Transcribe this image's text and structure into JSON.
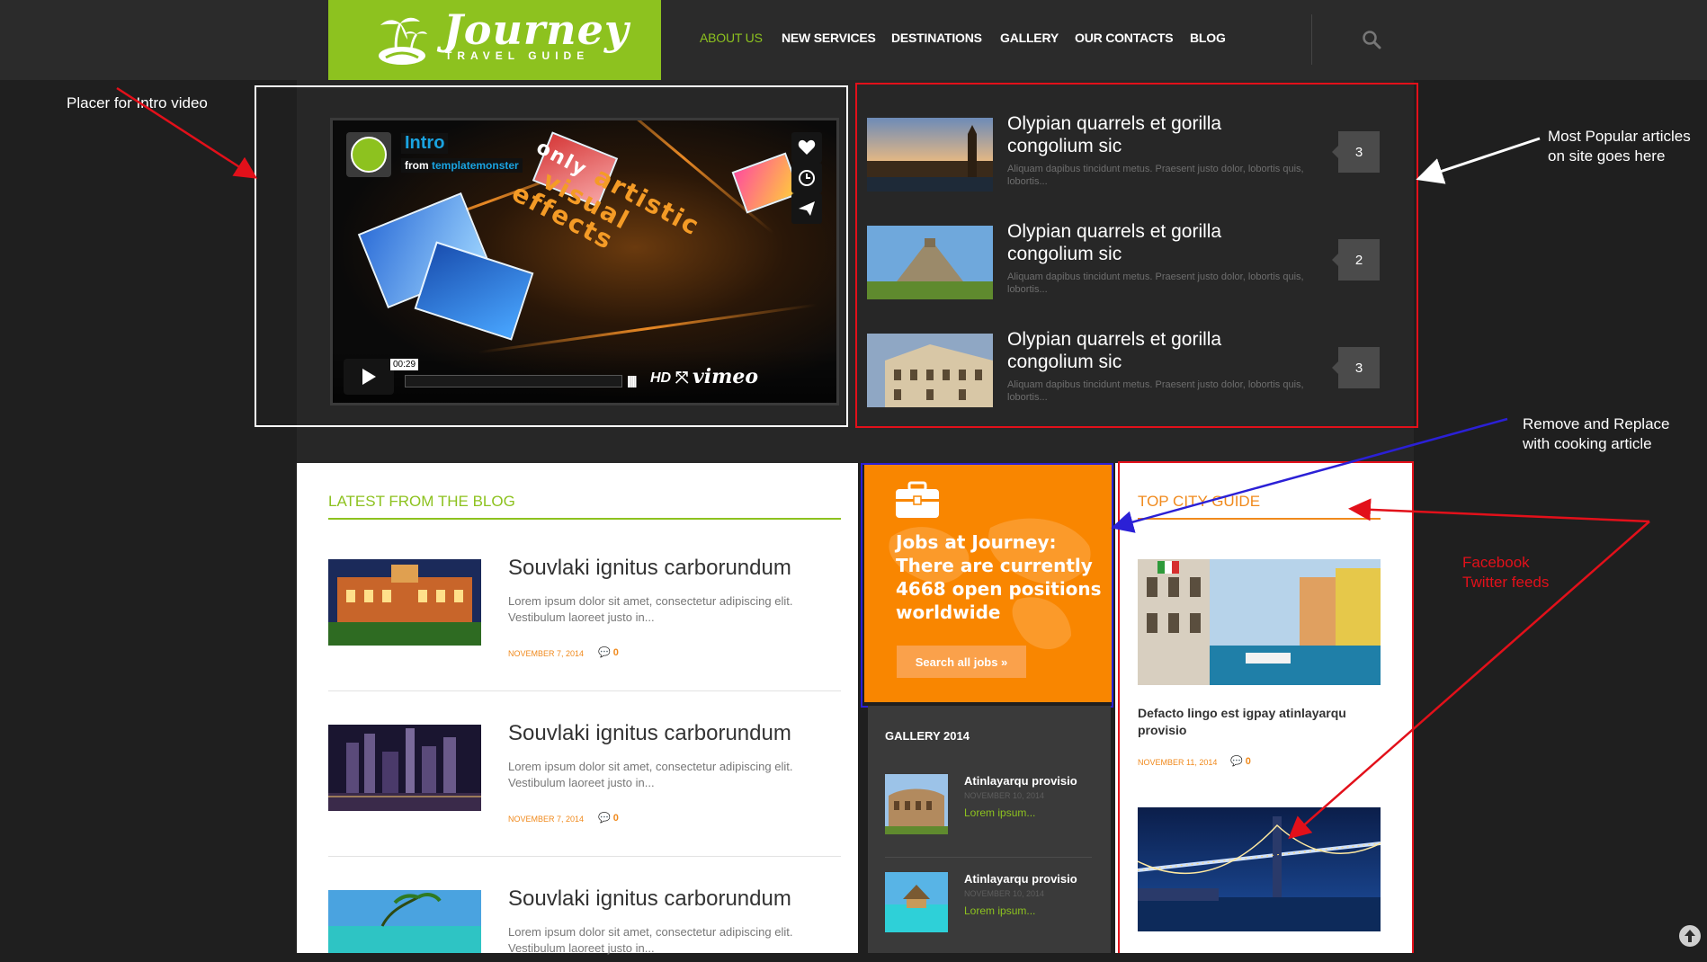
{
  "header": {
    "brand": "Journey",
    "tagline": "TRAVEL GUIDE",
    "nav": [
      "ABOUT US",
      "NEW SERVICES",
      "DESTINATIONS",
      "GALLERY",
      "OUR CONTACTS",
      "BLOG"
    ],
    "active_nav": "ABOUT US",
    "search_icon": "search-icon"
  },
  "video": {
    "title": "Intro",
    "from_label": "from",
    "author": "templatemonster",
    "overlay_words": [
      "only",
      "artistic",
      "visual",
      "effects"
    ],
    "time": "00:29",
    "hd_label": "HD",
    "vimeo_label": "vimeo",
    "icons": [
      "heart-icon",
      "clock-icon",
      "paper-plane-icon",
      "play-icon"
    ]
  },
  "popular": {
    "items": [
      {
        "title": "Olypian quarrels et gorilla congolium sic",
        "desc": "Aliquam dapibus tincidunt metus. Praesent justo dolor, lobortis quis, lobortis...",
        "count": "3"
      },
      {
        "title": "Olypian quarrels et gorilla congolium sic",
        "desc": "Aliquam dapibus tincidunt metus. Praesent justo dolor, lobortis quis, lobortis...",
        "count": "2"
      },
      {
        "title": "Olypian quarrels et gorilla congolium sic",
        "desc": "Aliquam dapibus tincidunt metus. Praesent justo dolor, lobortis quis, lobortis...",
        "count": "3"
      }
    ]
  },
  "annotations": {
    "intro_video": "Placer for Intro video",
    "popular_1": "Most Popular articles",
    "popular_2": "on site goes here",
    "replace_1": "Remove and Replace",
    "replace_2": "with cooking article",
    "feeds_1": "Facebook",
    "feeds_2": "Twitter feeds"
  },
  "blog": {
    "section_title": "LATEST FROM THE BLOG",
    "items": [
      {
        "title": "Souvlaki ignitus carborundum",
        "desc": "Lorem ipsum dolor sit amet, consectetur adipiscing elit. Vestibulum laoreet justo in...",
        "date": "NOVEMBER 7, 2014",
        "comments": "0"
      },
      {
        "title": "Souvlaki ignitus carborundum",
        "desc": "Lorem ipsum dolor sit amet, consectetur adipiscing elit. Vestibulum laoreet justo in...",
        "date": "NOVEMBER 7, 2014",
        "comments": "0"
      },
      {
        "title": "Souvlaki ignitus carborundum",
        "desc": "Lorem ipsum dolor sit amet, consectetur adipiscing elit. Vestibulum laoreet justo in...",
        "date": "",
        "comments": ""
      }
    ]
  },
  "jobs": {
    "text": "Jobs at Journey: There are currently 4668 open positions worldwide",
    "button": "Search all jobs »"
  },
  "gallery": {
    "title": "GALLERY 2014",
    "items": [
      {
        "title": "Atinlayarqu provisio",
        "date": "NOVEMBER 10, 2014",
        "link": "Lorem ipsum..."
      },
      {
        "title": "Atinlayarqu provisio",
        "date": "NOVEMBER 10, 2014",
        "link": "Lorem ipsum..."
      }
    ]
  },
  "city_guide": {
    "title": "TOP CITY GUIDE",
    "item_title": "Defacto lingo est igpay atinlayarqu provisio",
    "date": "NOVEMBER 11, 2014",
    "comments": "0"
  },
  "colors": {
    "brand_green": "#8dc21f",
    "accent_orange": "#f98600",
    "annotation_red": "#e2101a",
    "annotation_blue": "#2b20d6"
  }
}
